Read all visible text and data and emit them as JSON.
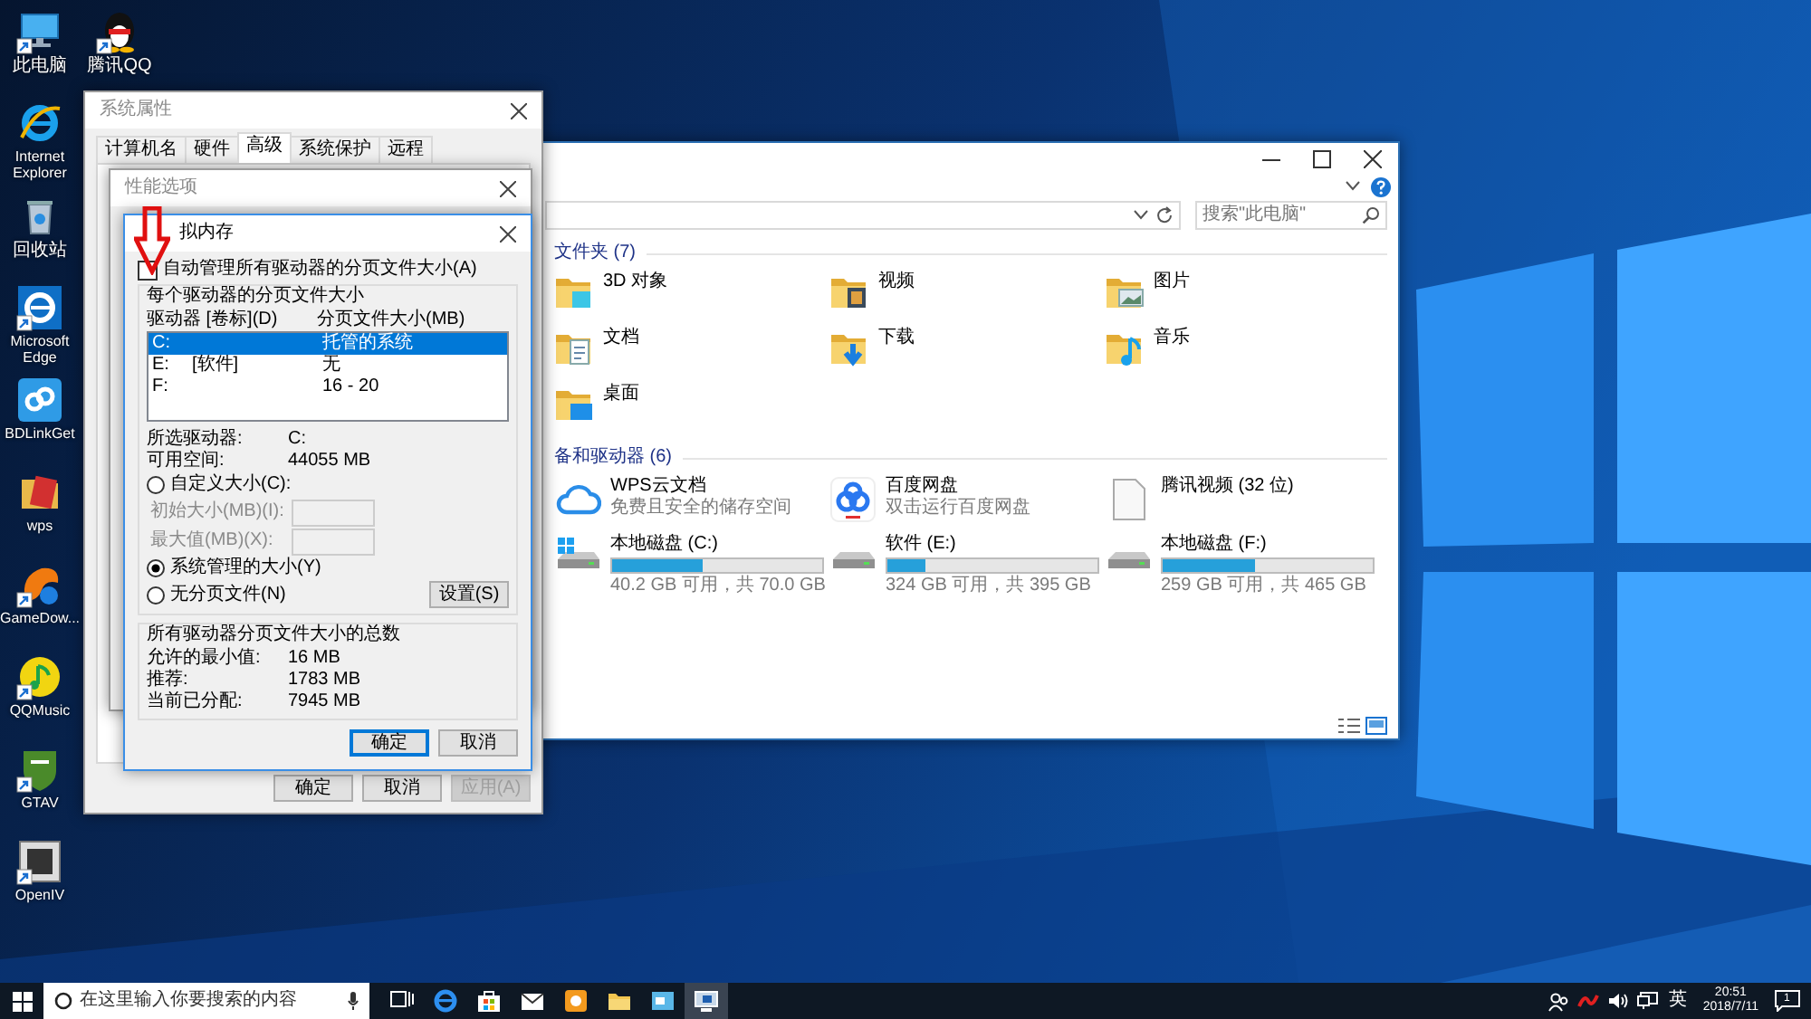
{
  "desktop": {
    "icons": [
      {
        "label": "此电脑",
        "kind": "pc",
        "shortcut": true
      },
      {
        "label": "Internet Explorer",
        "kind": "ie",
        "shortcut": false
      },
      {
        "label": "回收站",
        "kind": "bin",
        "shortcut": false
      },
      {
        "label": "Microsoft Edge",
        "kind": "edge",
        "shortcut": true
      },
      {
        "label": "BDLinkGet",
        "kind": "bdlink",
        "shortcut": false
      },
      {
        "label": "wps",
        "kind": "wps",
        "shortcut": false
      },
      {
        "label": "GameDow...",
        "kind": "game",
        "shortcut": true
      },
      {
        "label": "QQMusic",
        "kind": "music",
        "shortcut": true
      },
      {
        "label": "GTAV",
        "kind": "gta",
        "shortcut": true
      },
      {
        "label": "OpenIV",
        "kind": "openiv",
        "shortcut": true
      },
      {
        "label": "腾讯QQ",
        "kind": "qq",
        "shortcut": true
      }
    ]
  },
  "explorer": {
    "search": {
      "placeholder": "搜索\"此电脑\""
    },
    "sections": [
      {
        "title": "文件夹 (7)",
        "items": [
          {
            "label": "3D 对象",
            "kind": "objects"
          },
          {
            "label": "视频",
            "kind": "video"
          },
          {
            "label": "图片",
            "kind": "pictures"
          },
          {
            "label": "文档",
            "kind": "docs"
          },
          {
            "label": "下载",
            "kind": "downloads"
          },
          {
            "label": "音乐",
            "kind": "music"
          },
          {
            "label": "桌面",
            "kind": "desktop"
          }
        ]
      },
      {
        "title": "备和驱动器 (6)",
        "items": [
          {
            "label": "WPS云文档",
            "subtitle": "免费且安全的储存空间",
            "kind": "cloud"
          },
          {
            "label": "百度网盘",
            "subtitle": "双击运行百度网盘",
            "kind": "baidu"
          },
          {
            "label": "腾讯视频 (32 位)",
            "kind": "file"
          },
          {
            "label": "本地磁盘 (C:)",
            "kind": "system-drive",
            "level": 0.43,
            "free": "40.2 GB 可用，共 70.0 GB"
          },
          {
            "label": "软件 (E:)",
            "kind": "drive",
            "level": 0.18,
            "free": "324 GB 可用，共 395 GB"
          },
          {
            "label": "本地磁盘 (F:)",
            "kind": "drive",
            "level": 0.44,
            "free": "259 GB 可用，共 465 GB"
          }
        ]
      }
    ]
  },
  "system_properties": {
    "title": "系统属性",
    "tabs": [
      {
        "label": "计算机名",
        "selected": false
      },
      {
        "label": "硬件",
        "selected": false
      },
      {
        "label": "高级",
        "selected": true
      },
      {
        "label": "系统保护",
        "selected": false
      },
      {
        "label": "远程",
        "selected": false
      }
    ],
    "buttons": [
      {
        "label": "确定",
        "disabled": false
      },
      {
        "label": "取消",
        "disabled": false
      },
      {
        "label": "应用(A)",
        "disabled": true
      }
    ]
  },
  "performance_options": {
    "title": "性能选项"
  },
  "virtual_memory": {
    "title": "拟内存",
    "auto_manage": {
      "label": "自动管理所有驱动器的分页文件大小(A)",
      "checked": false
    },
    "drive_group": {
      "title": "每个驱动器的分页文件大小",
      "columns": [
        "驱动器 [卷标](D)",
        "分页文件大小(MB)"
      ],
      "drives": [
        {
          "drive": "C:",
          "size": "托管的系统",
          "selected": true
        },
        {
          "drive": "E:",
          "label": "[软件]",
          "size": "无",
          "selected": false
        },
        {
          "drive": "F:",
          "size": "16 - 20",
          "selected": false
        }
      ],
      "info": [
        {
          "label": "所选驱动器:",
          "value": "C:"
        },
        {
          "label": "可用空间:",
          "value": "44055 MB"
        }
      ],
      "options": [
        {
          "kind": "radio",
          "label": "自定义大小(C):",
          "selected": false
        },
        {
          "kind": "field",
          "label": "初始大小(MB)(I):",
          "disabled": true
        },
        {
          "kind": "field",
          "label": "最大值(MB)(X):",
          "disabled": true
        },
        {
          "kind": "radio",
          "label": "系统管理的大小(Y)",
          "selected": true
        },
        {
          "kind": "radio",
          "label": "无分页文件(N)",
          "selected": false
        }
      ],
      "set_button": "设置(S)"
    },
    "totals": {
      "title": "所有驱动器分页文件大小的总数",
      "rows": [
        {
          "label": "允许的最小值:",
          "value": "16 MB"
        },
        {
          "label": "推荐:",
          "value": "1783 MB"
        },
        {
          "label": "当前已分配:",
          "value": "7945 MB"
        }
      ]
    },
    "buttons": [
      {
        "label": "确定",
        "default": true
      },
      {
        "label": "取消",
        "default": false
      }
    ]
  },
  "taskbar": {
    "search": {
      "placeholder": "在这里输入你要搜索的内容"
    },
    "apps": [
      {
        "kind": "taskview",
        "active": false
      },
      {
        "kind": "browser",
        "active": false
      },
      {
        "kind": "store",
        "active": false
      },
      {
        "kind": "mail",
        "active": false
      },
      {
        "kind": "orange",
        "active": false
      },
      {
        "kind": "folder",
        "active": false
      },
      {
        "kind": "window",
        "active": false
      },
      {
        "kind": "computer",
        "active": true
      }
    ],
    "tray": {
      "language": "英",
      "time": "20:51",
      "date": "2018/7/11",
      "notifications": "1"
    }
  }
}
